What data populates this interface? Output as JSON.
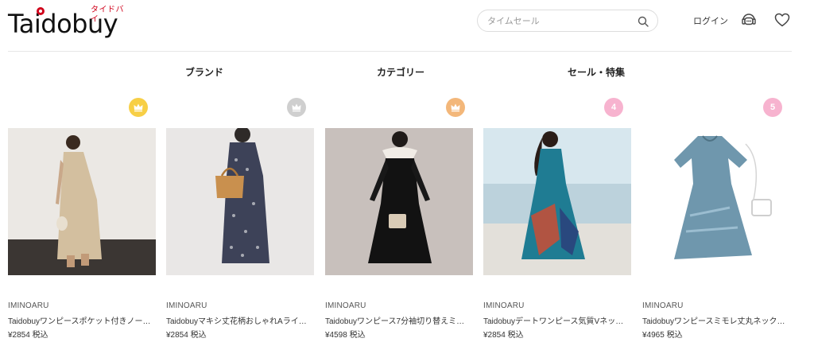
{
  "header": {
    "logo_text": "Taidobuy",
    "logo_kana": "タイドバイ",
    "search_placeholder": "タイムセール",
    "login_label": "ログイン"
  },
  "nav": {
    "items": [
      "ブランド",
      "カテゴリー",
      "セール・特集"
    ]
  },
  "products": [
    {
      "rank": "1",
      "badge_color": "#f7cf46",
      "brand": "IMINOARU",
      "title": "Taidobuyワンピースポケット付きノー…",
      "price": "¥2854",
      "tax": "税込"
    },
    {
      "rank": "2",
      "badge_color": "#cfcfcf",
      "brand": "IMINOARU",
      "title": "Taidobuyマキシ丈花柄おしゃれAライ…",
      "price": "¥2854",
      "tax": "税込"
    },
    {
      "rank": "3",
      "badge_color": "#f3b77a",
      "brand": "IMINOARU",
      "title": "Taidobuyワンピース7分袖切り替えミ…",
      "price": "¥4598",
      "tax": "税込"
    },
    {
      "rank": "4",
      "badge_color": "#f7b3cf",
      "brand": "IMINOARU",
      "title": "Taidobuyデートワンピース気質Vネッ…",
      "price": "¥2854",
      "tax": "税込"
    },
    {
      "rank": "5",
      "badge_color": "#f7b3cf",
      "brand": "IMINOARU",
      "title": "Taidobuyワンピースミモレ丈丸ネック…",
      "price": "¥4965",
      "tax": "税込"
    }
  ]
}
